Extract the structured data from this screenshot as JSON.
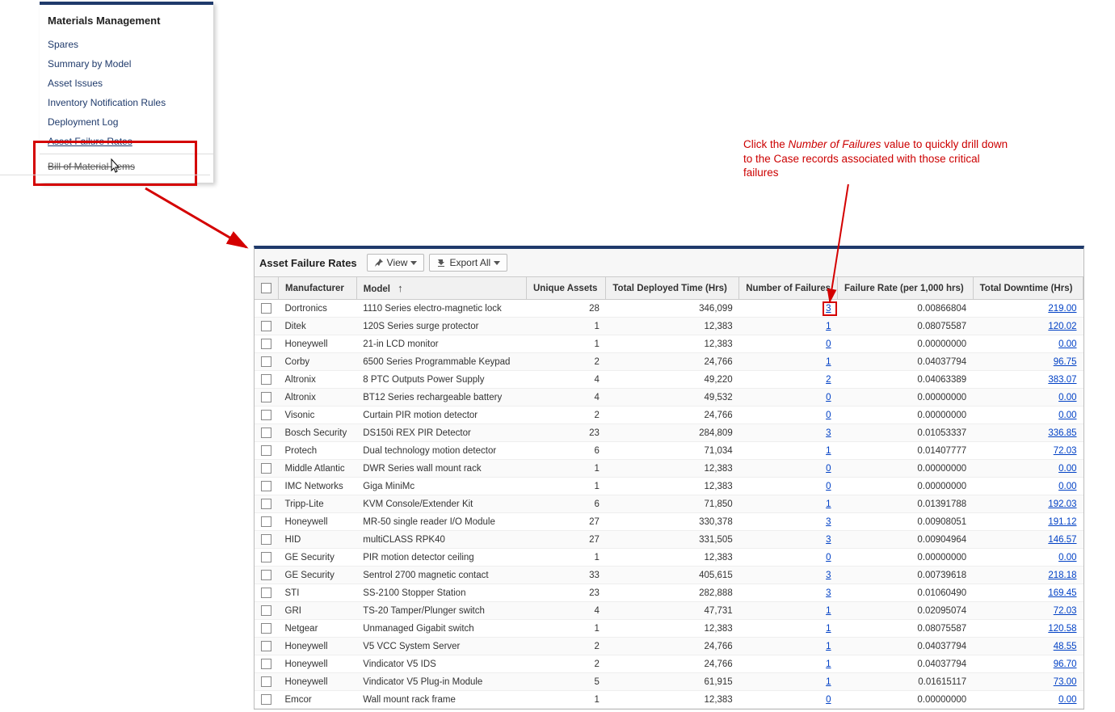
{
  "sidebar": {
    "title": "Materials Management",
    "items": [
      {
        "label": "Spares"
      },
      {
        "label": "Summary by Model"
      },
      {
        "label": "Asset Issues"
      },
      {
        "label": "Inventory Notification Rules"
      },
      {
        "label": "Deployment Log"
      },
      {
        "label": "Asset Failure Rates",
        "active": true
      },
      {
        "label": "Bill of Material Items",
        "strike": true
      }
    ]
  },
  "annotation": {
    "pre": "Click the ",
    "em": "Number of Failures",
    "post": " value to quickly drill down to the Case records associated with those critical failures"
  },
  "panel": {
    "title": "Asset Failure Rates",
    "view_label": "View",
    "export_label": "Export All"
  },
  "columns": {
    "manufacturer": "Manufacturer",
    "model": "Model",
    "unique_assets": "Unique Assets",
    "deployed_time": "Total Deployed Time (Hrs)",
    "num_failures": "Number of Failures",
    "failure_rate": "Failure Rate (per 1,000 hrs)",
    "total_downtime": "Total Downtime (Hrs)"
  },
  "rows": [
    {
      "manufacturer": "Dortronics",
      "model": "1110 Series electro-magnetic lock",
      "assets": "28",
      "deployed": "346,099",
      "failures": "3",
      "rate": "0.00866804",
      "downtime": "219.00"
    },
    {
      "manufacturer": "Ditek",
      "model": "120S Series surge protector",
      "assets": "1",
      "deployed": "12,383",
      "failures": "1",
      "rate": "0.08075587",
      "downtime": "120.02"
    },
    {
      "manufacturer": "Honeywell",
      "model": "21-in LCD monitor",
      "assets": "1",
      "deployed": "12,383",
      "failures": "0",
      "rate": "0.00000000",
      "downtime": "0.00"
    },
    {
      "manufacturer": "Corby",
      "model": "6500 Series Programmable Keypad",
      "assets": "2",
      "deployed": "24,766",
      "failures": "1",
      "rate": "0.04037794",
      "downtime": "96.75"
    },
    {
      "manufacturer": "Altronix",
      "model": "8 PTC Outputs Power Supply",
      "assets": "4",
      "deployed": "49,220",
      "failures": "2",
      "rate": "0.04063389",
      "downtime": "383.07"
    },
    {
      "manufacturer": "Altronix",
      "model": "BT12 Series rechargeable battery",
      "assets": "4",
      "deployed": "49,532",
      "failures": "0",
      "rate": "0.00000000",
      "downtime": "0.00"
    },
    {
      "manufacturer": "Visonic",
      "model": "Curtain PIR motion detector",
      "assets": "2",
      "deployed": "24,766",
      "failures": "0",
      "rate": "0.00000000",
      "downtime": "0.00"
    },
    {
      "manufacturer": "Bosch Security",
      "model": "DS150i REX PIR Detector",
      "assets": "23",
      "deployed": "284,809",
      "failures": "3",
      "rate": "0.01053337",
      "downtime": "336.85"
    },
    {
      "manufacturer": "Protech",
      "model": "Dual technology motion detector",
      "assets": "6",
      "deployed": "71,034",
      "failures": "1",
      "rate": "0.01407777",
      "downtime": "72.03"
    },
    {
      "manufacturer": "Middle Atlantic",
      "model": "DWR Series wall mount rack",
      "assets": "1",
      "deployed": "12,383",
      "failures": "0",
      "rate": "0.00000000",
      "downtime": "0.00"
    },
    {
      "manufacturer": "IMC Networks",
      "model": "Giga MiniMc",
      "assets": "1",
      "deployed": "12,383",
      "failures": "0",
      "rate": "0.00000000",
      "downtime": "0.00"
    },
    {
      "manufacturer": "Tripp-Lite",
      "model": "KVM Console/Extender Kit",
      "assets": "6",
      "deployed": "71,850",
      "failures": "1",
      "rate": "0.01391788",
      "downtime": "192.03"
    },
    {
      "manufacturer": "Honeywell",
      "model": "MR-50 single reader I/O Module",
      "assets": "27",
      "deployed": "330,378",
      "failures": "3",
      "rate": "0.00908051",
      "downtime": "191.12"
    },
    {
      "manufacturer": "HID",
      "model": "multiCLASS RPK40",
      "assets": "27",
      "deployed": "331,505",
      "failures": "3",
      "rate": "0.00904964",
      "downtime": "146.57"
    },
    {
      "manufacturer": "GE Security",
      "model": "PIR motion detector ceiling",
      "assets": "1",
      "deployed": "12,383",
      "failures": "0",
      "rate": "0.00000000",
      "downtime": "0.00"
    },
    {
      "manufacturer": "GE Security",
      "model": "Sentrol 2700 magnetic contact",
      "assets": "33",
      "deployed": "405,615",
      "failures": "3",
      "rate": "0.00739618",
      "downtime": "218.18"
    },
    {
      "manufacturer": "STI",
      "model": "SS-2100 Stopper Station",
      "assets": "23",
      "deployed": "282,888",
      "failures": "3",
      "rate": "0.01060490",
      "downtime": "169.45"
    },
    {
      "manufacturer": "GRI",
      "model": "TS-20 Tamper/Plunger switch",
      "assets": "4",
      "deployed": "47,731",
      "failures": "1",
      "rate": "0.02095074",
      "downtime": "72.03"
    },
    {
      "manufacturer": "Netgear",
      "model": "Unmanaged Gigabit switch",
      "assets": "1",
      "deployed": "12,383",
      "failures": "1",
      "rate": "0.08075587",
      "downtime": "120.58"
    },
    {
      "manufacturer": "Honeywell",
      "model": "V5 VCC System Server",
      "assets": "2",
      "deployed": "24,766",
      "failures": "1",
      "rate": "0.04037794",
      "downtime": "48.55"
    },
    {
      "manufacturer": "Honeywell",
      "model": "Vindicator V5 IDS",
      "assets": "2",
      "deployed": "24,766",
      "failures": "1",
      "rate": "0.04037794",
      "downtime": "96.70"
    },
    {
      "manufacturer": "Honeywell",
      "model": "Vindicator V5 Plug-in Module",
      "assets": "5",
      "deployed": "61,915",
      "failures": "1",
      "rate": "0.01615117",
      "downtime": "73.00"
    },
    {
      "manufacturer": "Emcor",
      "model": "Wall mount rack frame",
      "assets": "1",
      "deployed": "12,383",
      "failures": "0",
      "rate": "0.00000000",
      "downtime": "0.00"
    }
  ]
}
